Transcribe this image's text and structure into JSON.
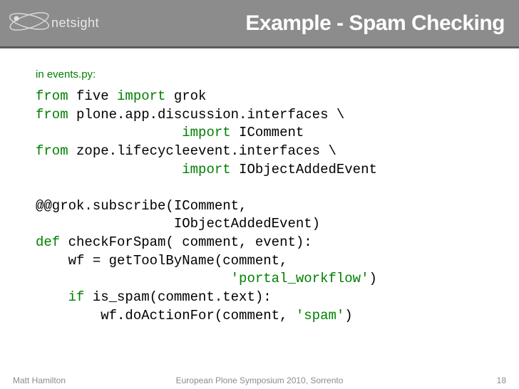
{
  "header": {
    "logo_text": "netsight",
    "title": "Example - Spam Checking"
  },
  "content": {
    "subtitle": "in events.py:",
    "code": {
      "l1_a": "from",
      "l1_b": " five ",
      "l1_c": "import",
      "l1_d": " grok",
      "l2_a": "from",
      "l2_b": " plone.app.discussion.interfaces \\",
      "l3_a": "                  ",
      "l3_b": "import",
      "l3_c": " IComment",
      "l4_a": "from",
      "l4_b": " zope.lifecycleevent.interfaces \\",
      "l5_a": "                  ",
      "l5_b": "import",
      "l5_c": " IObjectAddedEvent",
      "l6": "",
      "l7": "@@grok.subscribe(IComment,",
      "l8": "                 IObjectAddedEvent)",
      "l9_a": "def",
      "l9_b": " checkForSpam( comment, event):",
      "l10": "    wf = getToolByName(comment,",
      "l11_a": "                        ",
      "l11_b": "'portal_workflow'",
      "l11_c": ")",
      "l12_a": "    ",
      "l12_b": "if",
      "l12_c": " is_spam(comment.text):",
      "l13_a": "        wf.doActionFor(comment, ",
      "l13_b": "'spam'",
      "l13_c": ")"
    }
  },
  "footer": {
    "author": "Matt Hamilton",
    "event": "European Plone Symposium 2010, Sorrento",
    "page": "18"
  }
}
